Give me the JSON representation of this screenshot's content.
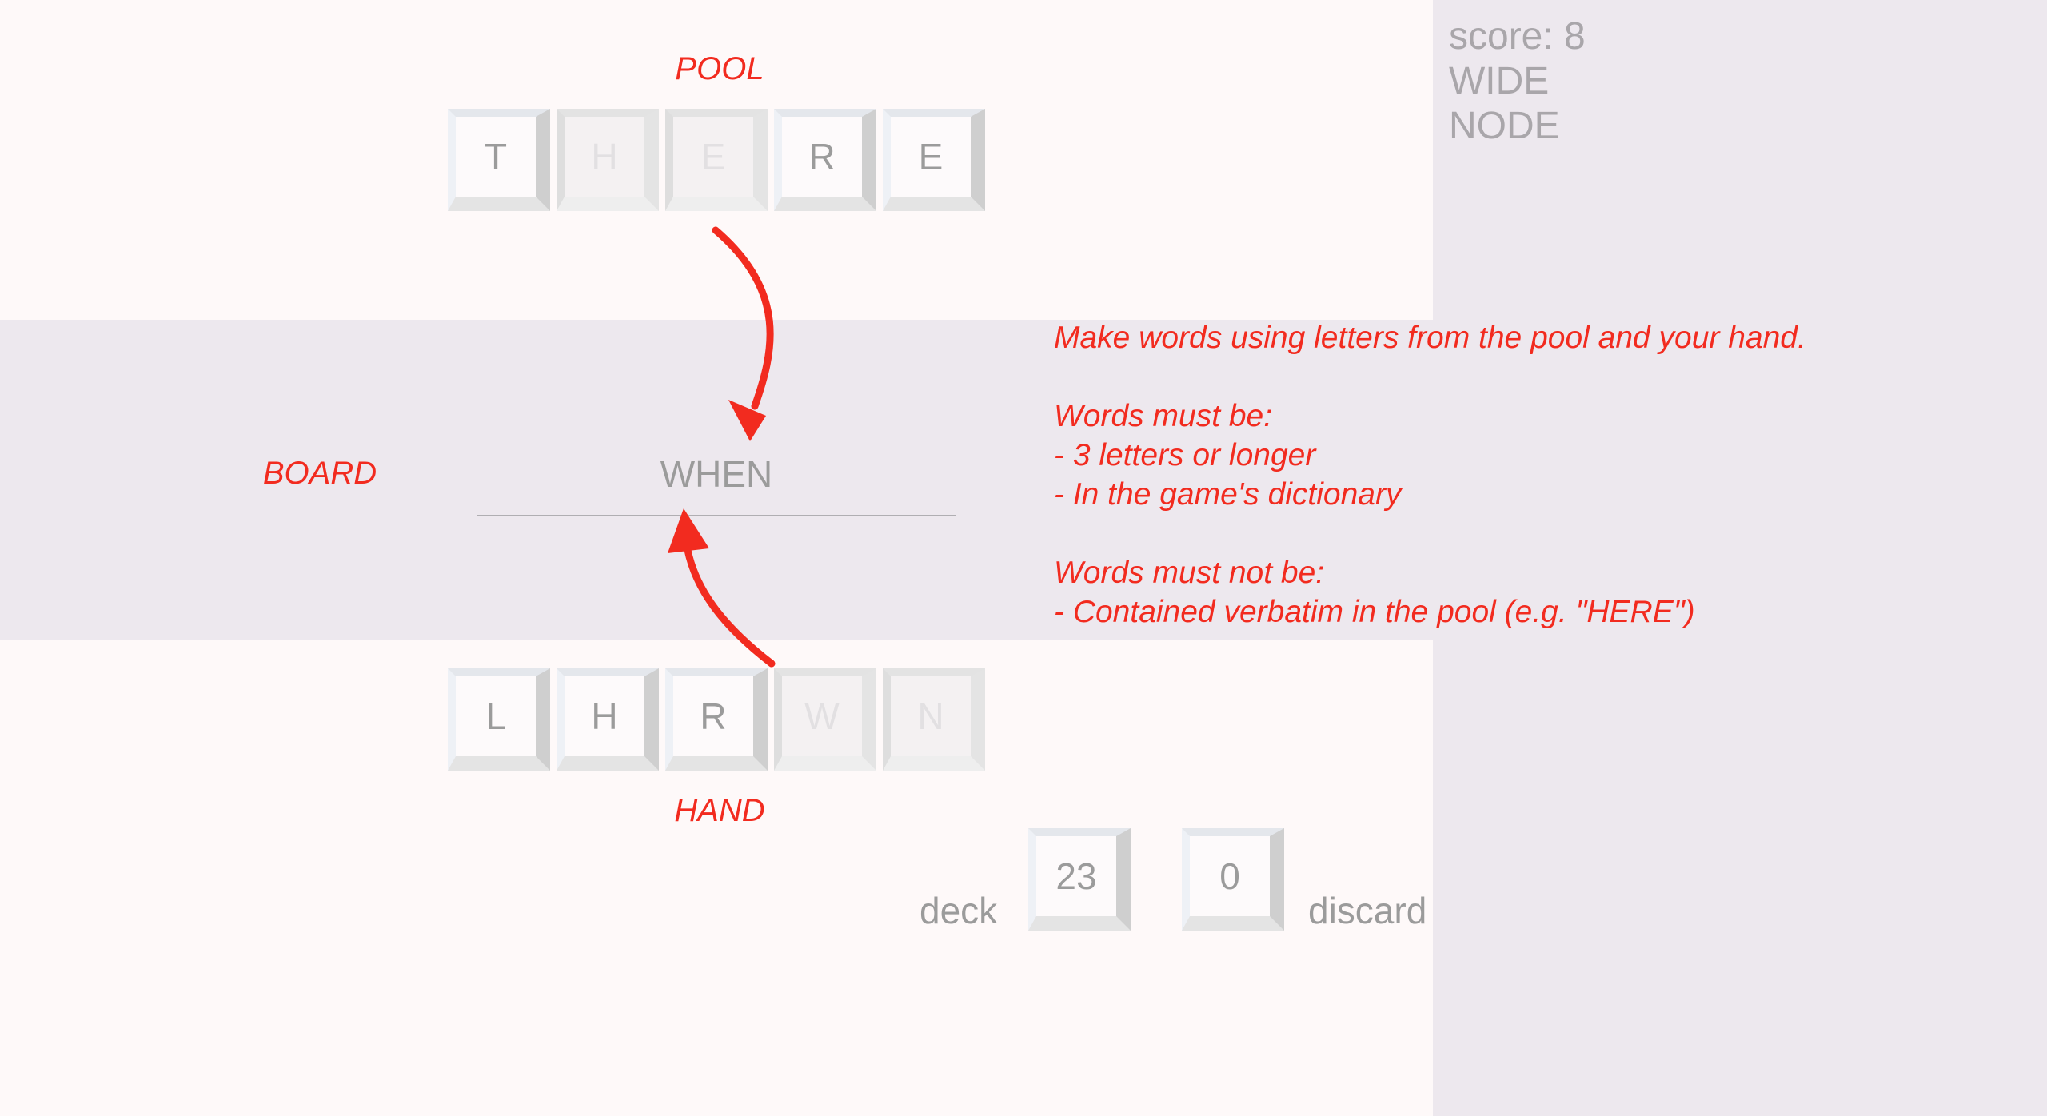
{
  "sidebar": {
    "score_label": "score: 8",
    "words": [
      "WIDE",
      "NODE"
    ]
  },
  "labels": {
    "pool": "POOL",
    "board": "BOARD",
    "hand": "HAND"
  },
  "pool": {
    "tiles": [
      {
        "letter": "T",
        "used": false
      },
      {
        "letter": "H",
        "used": true
      },
      {
        "letter": "E",
        "used": true
      },
      {
        "letter": "R",
        "used": false
      },
      {
        "letter": "E",
        "used": false
      }
    ]
  },
  "board": {
    "word": "WHEN"
  },
  "hand": {
    "tiles": [
      {
        "letter": "L",
        "used": false
      },
      {
        "letter": "H",
        "used": false
      },
      {
        "letter": "R",
        "used": false
      },
      {
        "letter": "W",
        "used": true
      },
      {
        "letter": "N",
        "used": true
      }
    ]
  },
  "piles": {
    "deck_label": "deck",
    "deck_count": "23",
    "discard_label": "discard",
    "discard_count": "0"
  },
  "instructions": {
    "lines": [
      "Make words using letters from the pool and your hand.",
      "",
      "Words must be:",
      "- 3 letters or longer",
      "- In the game's dictionary",
      "",
      "Words must not be:",
      "- Contained verbatim in the pool (e.g. \"HERE\")"
    ]
  },
  "colors": {
    "annotation": "#f22b1f",
    "sidebar_bg": "#ede8ee",
    "page_bg": "#fef9f9",
    "tile_text": "#9b9b9b"
  }
}
